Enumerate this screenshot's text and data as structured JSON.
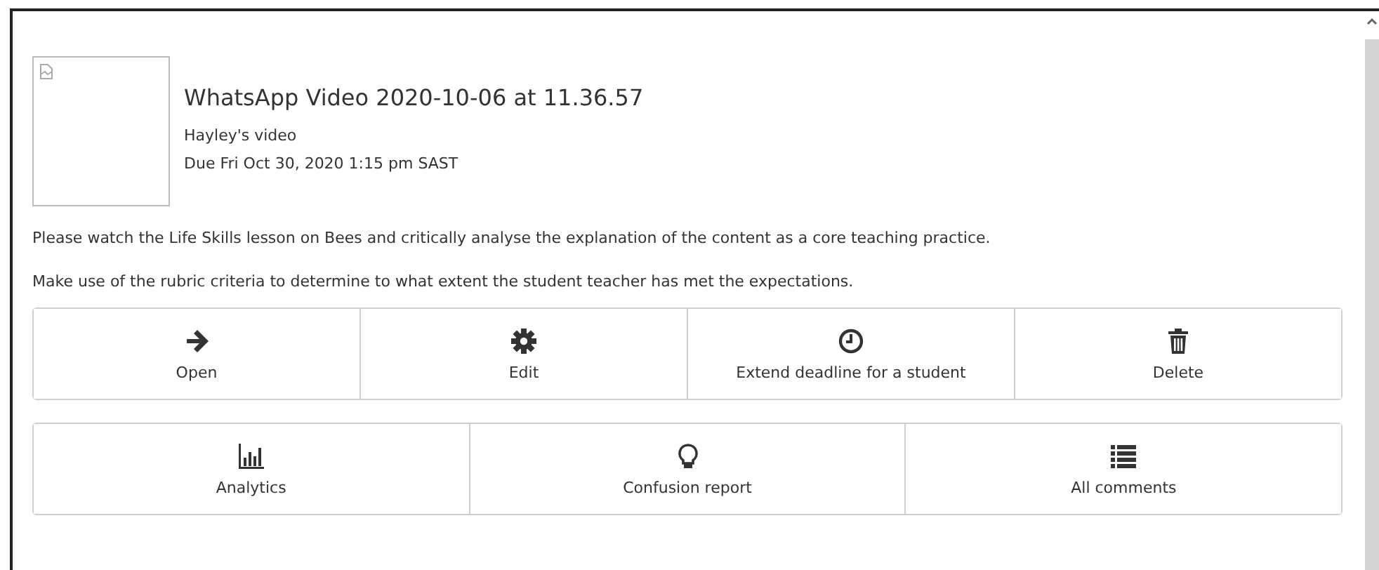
{
  "assignment": {
    "title": "WhatsApp Video 2020-10-06 at 11.36.57",
    "subtitle": "Hayley's video",
    "due": "Due Fri Oct 30, 2020 1:15 pm SAST"
  },
  "description": [
    "Please watch the Life Skills lesson on Bees and critically analyse the explanation of the content as a core teaching practice.",
    "Make use of the rubric criteria to determine to what extent the student teacher has met the expectations."
  ],
  "action_rows": [
    [
      {
        "kind": "arrow",
        "label": "Open"
      },
      {
        "kind": "gear",
        "label": "Edit"
      },
      {
        "kind": "clock",
        "label": "Extend deadline for a student"
      },
      {
        "kind": "trash",
        "label": "Delete"
      }
    ],
    [
      {
        "kind": "chart",
        "label": "Analytics"
      },
      {
        "kind": "bulb",
        "label": "Confusion report"
      },
      {
        "kind": "list",
        "label": "All comments"
      }
    ]
  ]
}
